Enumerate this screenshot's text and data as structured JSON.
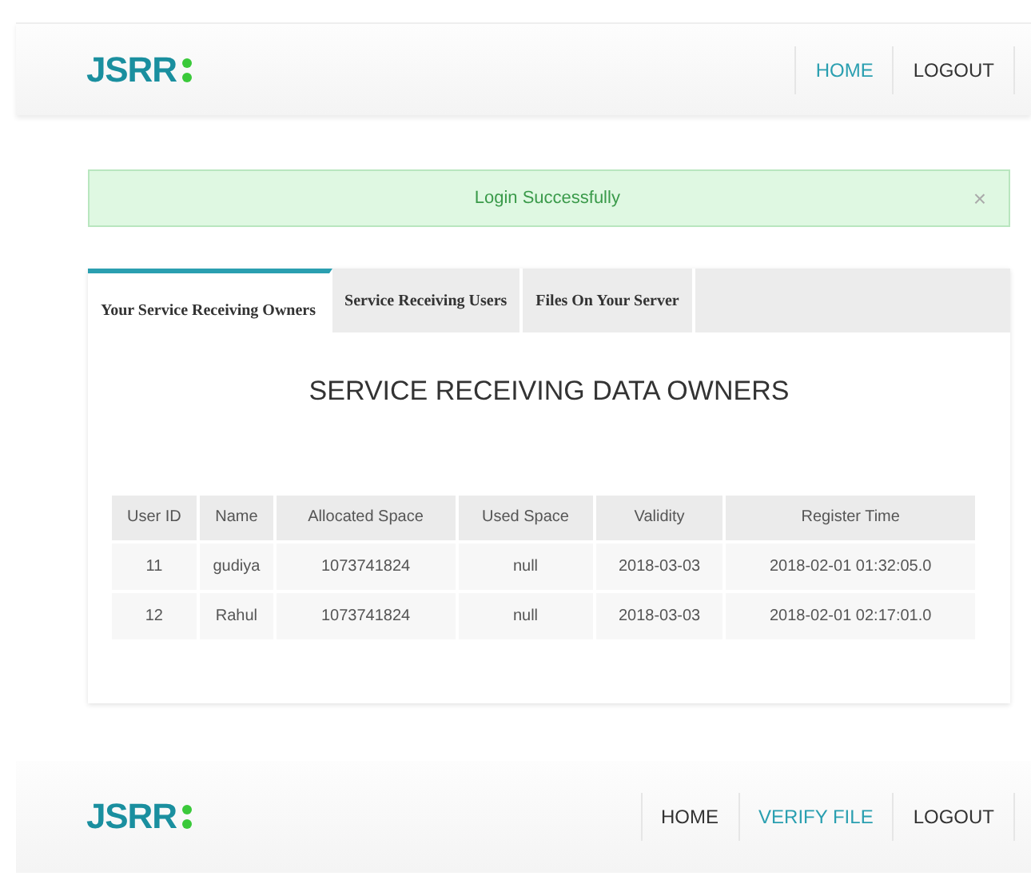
{
  "header": {
    "logo": "JSRR",
    "nav": [
      {
        "label": "HOME",
        "selected": true
      },
      {
        "label": "LOGOUT",
        "selected": false
      }
    ]
  },
  "alert": {
    "message": "Login Successfully",
    "close": "×"
  },
  "tabs": [
    {
      "label": "Your Service Receiving Owners",
      "selected": true
    },
    {
      "label": "Service Receiving Users",
      "selected": false
    },
    {
      "label": "Files On Your Server",
      "selected": false
    }
  ],
  "panel": {
    "title": "SERVICE RECEIVING DATA OWNERS"
  },
  "table": {
    "columns": [
      "User ID",
      "Name",
      "Allocated Space",
      "Used Space",
      "Validity",
      "Register Time"
    ],
    "rows": [
      [
        "11",
        "gudiya",
        "1073741824",
        "null",
        "2018-03-03",
        "2018-02-01 01:32:05.0"
      ],
      [
        "12",
        "Rahul",
        "1073741824",
        "null",
        "2018-03-03",
        "2018-02-01 02:17:01.0"
      ]
    ]
  },
  "footer": {
    "logo": "JSRR",
    "nav": [
      {
        "label": "HOME",
        "selected": false
      },
      {
        "label": "VERIFY FILE",
        "selected": true
      },
      {
        "label": "LOGOUT",
        "selected": false
      }
    ]
  }
}
